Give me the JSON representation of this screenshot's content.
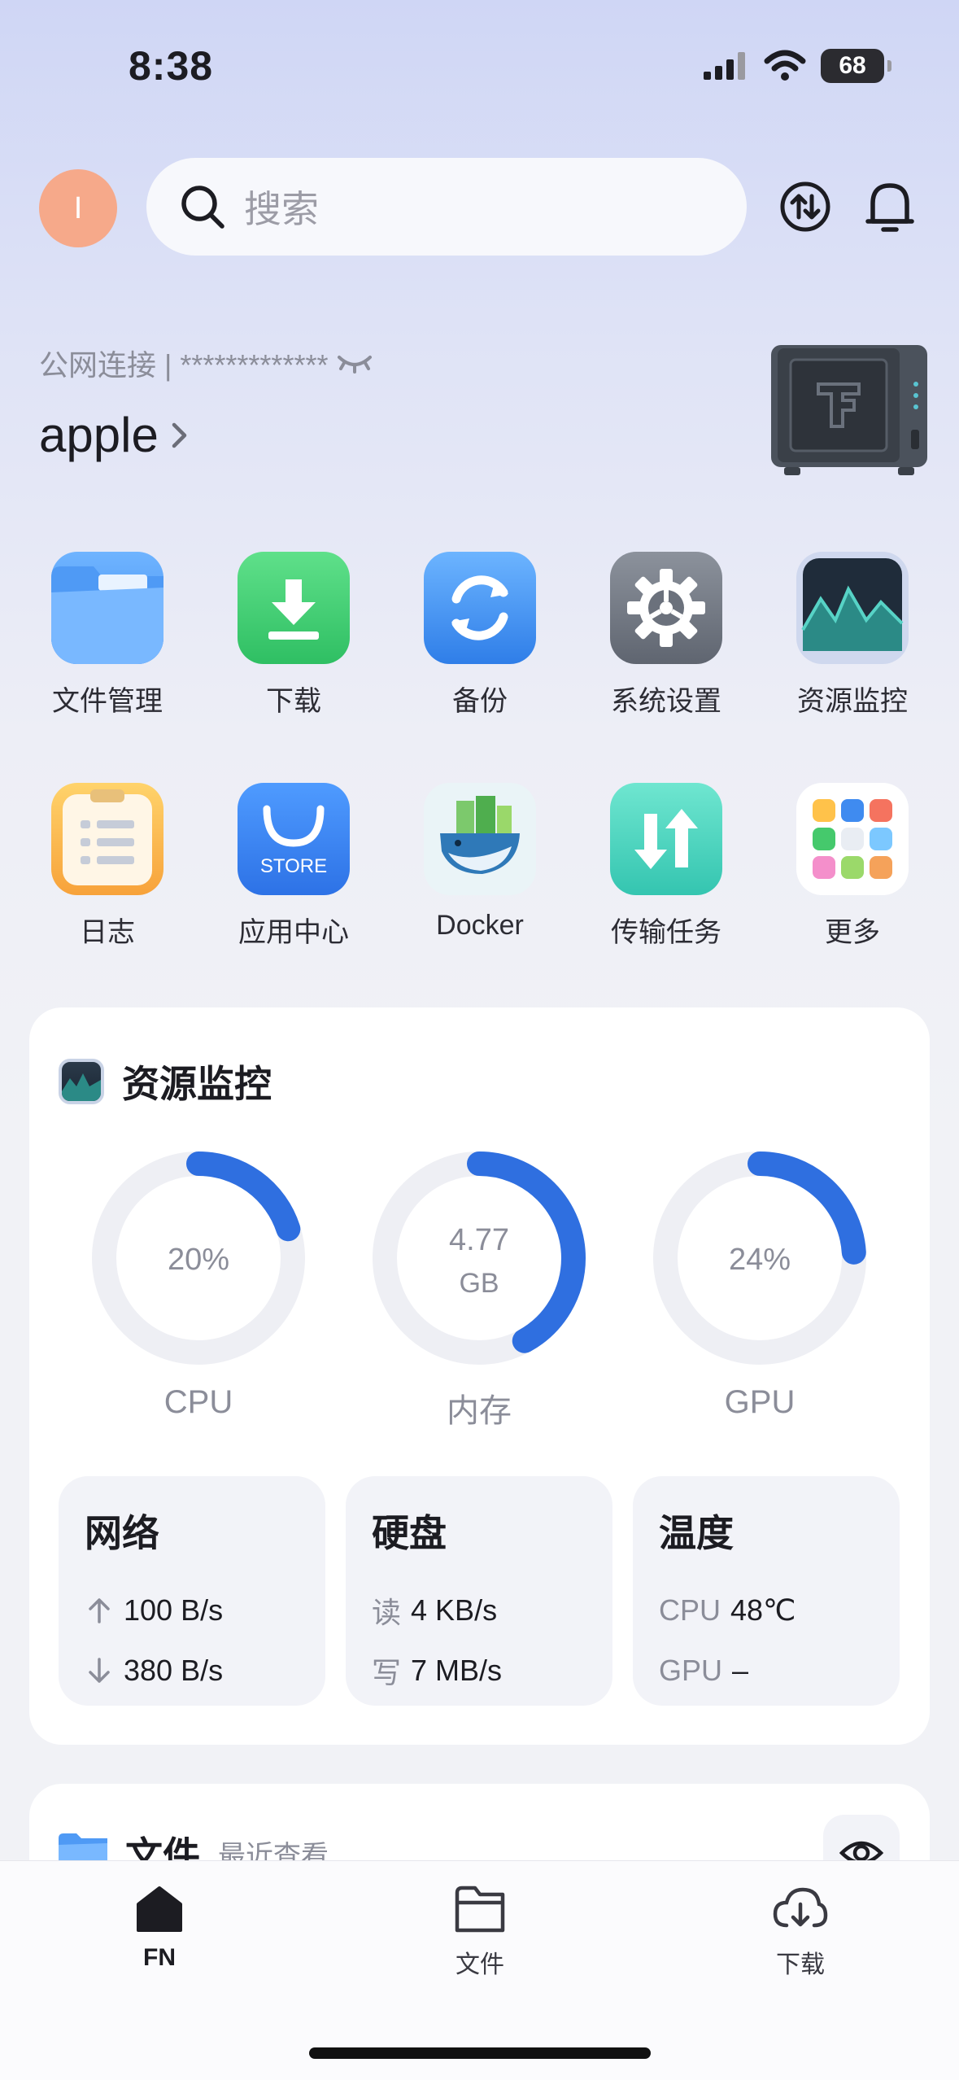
{
  "status_bar": {
    "time": "8:38",
    "battery": "68"
  },
  "header": {
    "avatar_initial": "I",
    "search_placeholder": "搜索"
  },
  "device": {
    "connection_text": "公网连接 | *************",
    "name": "apple"
  },
  "apps": [
    {
      "label": "文件管理",
      "icon": "folder-icon"
    },
    {
      "label": "下载",
      "icon": "download-icon"
    },
    {
      "label": "备份",
      "icon": "backup-icon"
    },
    {
      "label": "系统设置",
      "icon": "gear-icon"
    },
    {
      "label": "资源监控",
      "icon": "monitor-icon"
    },
    {
      "label": "日志",
      "icon": "log-icon"
    },
    {
      "label": "应用中心",
      "icon": "store-icon"
    },
    {
      "label": "Docker",
      "icon": "docker-whale-icon"
    },
    {
      "label": "传输任务",
      "icon": "transfer-icon"
    },
    {
      "label": "更多",
      "icon": "more-grid-icon"
    }
  ],
  "monitor": {
    "title": "资源监控",
    "gauges": [
      {
        "label": "CPU",
        "value_text": "20%",
        "unit": "",
        "fraction": 0.2
      },
      {
        "label": "内存",
        "value_text": "4.77",
        "unit": "GB",
        "fraction": 0.42
      },
      {
        "label": "GPU",
        "value_text": "24%",
        "unit": "",
        "fraction": 0.24
      }
    ],
    "network": {
      "title": "网络",
      "up": "100 B/s",
      "down": "380 B/s"
    },
    "disk": {
      "title": "硬盘",
      "read_label": "读",
      "read": "4 KB/s",
      "write_label": "写",
      "write": "7 MB/s"
    },
    "temperature": {
      "title": "温度",
      "cpu_label": "CPU",
      "cpu": "48℃",
      "gpu_label": "GPU",
      "gpu": "–"
    },
    "accent_color": "#2f6fe0",
    "track_color": "#eeeff4"
  },
  "files_card": {
    "title": "文件",
    "subtitle": "最近查看"
  },
  "tabbar": {
    "tabs": [
      {
        "label": "FN"
      },
      {
        "label": "文件"
      },
      {
        "label": "下载"
      }
    ]
  }
}
